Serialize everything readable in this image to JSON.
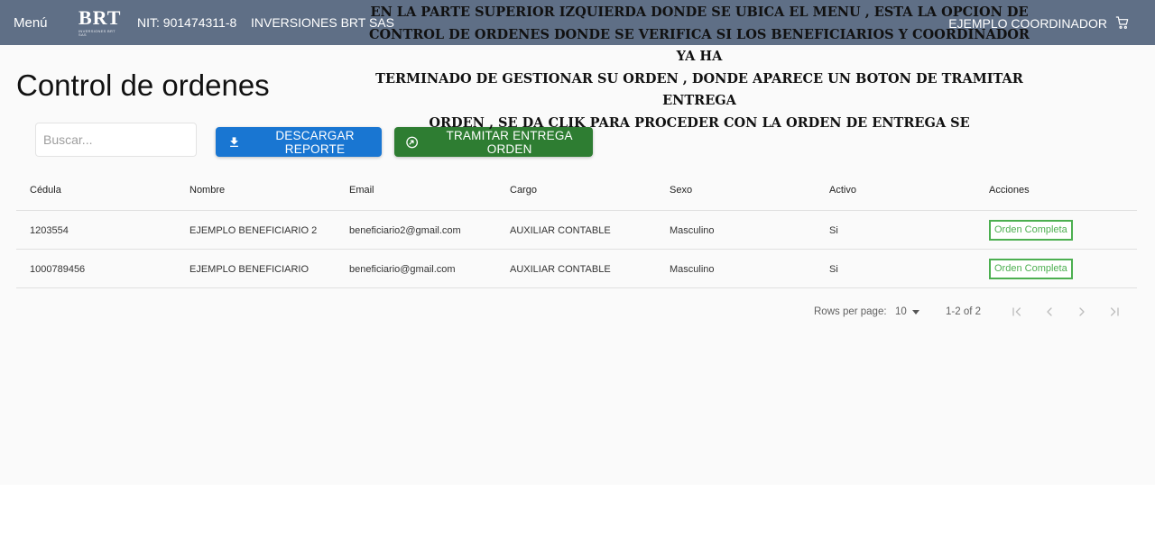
{
  "header": {
    "menu_label": "Menú",
    "logo_text": "BRT",
    "logo_subtext": "INVERSIONES BRT SAS",
    "nit": "NIT: 901474311-8",
    "company": "INVERSIONES BRT SAS",
    "user": "EJEMPLO COORDINADOR",
    "bar_color": "#5f6f86"
  },
  "annotation": {
    "lines": [
      "EN LA PARTE SUPERIOR IZQUIERDA DONDE SE UBICA EL MENU , ESTA LA OPCION DE",
      "CONTROL DE ORDENES DONDE SE VERIFICA SI LOS BENEFICIARIOS  Y COORDINADOR YA HA",
      "TERMINADO DE GESTIONAR SU ORDEN , DONDE APARECE UN BOTON DE TRAMITAR ENTREGA",
      "ORDEN , SE DA CLIK PARA PROCEDER CON LA ORDEN DE ENTREGA SE"
    ]
  },
  "page": {
    "title": "Control de ordenes"
  },
  "toolbar": {
    "search_placeholder": "Buscar...",
    "download_label": "DESCARGAR REPORTE",
    "process_label": "TRAMITAR ENTREGA ORDEN",
    "download_color": "#1976d2",
    "process_color": "#2e7d32"
  },
  "table": {
    "columns": [
      "Cédula",
      "Nombre",
      "Email",
      "Cargo",
      "Sexo",
      "Activo",
      "Acciones"
    ],
    "rows": [
      {
        "cedula": "1203554",
        "nombre": "EJEMPLO BENEFICIARIO 2",
        "email": "beneficiario2@gmail.com",
        "cargo": "AUXILIAR CONTABLE",
        "sexo": "Masculino",
        "activo": "Si",
        "accion": "Orden Completa"
      },
      {
        "cedula": "1000789456",
        "nombre": "EJEMPLO BENEFICIARIO",
        "email": "beneficiario@gmail.com",
        "cargo": "AUXILIAR CONTABLE",
        "sexo": "Masculino",
        "activo": "Si",
        "accion": "Orden Completa"
      }
    ],
    "status_color": "#4caf50"
  },
  "pagination": {
    "rows_per_page_label": "Rows per page:",
    "rows_per_page": "10",
    "range": "1-2 of 2"
  },
  "icons": {
    "cart": "cart-icon",
    "download": "download-icon",
    "process": "arrow-circle-icon",
    "first": "first-page-icon",
    "prev": "chevron-left-icon",
    "next": "chevron-right-icon",
    "last": "last-page-icon"
  }
}
